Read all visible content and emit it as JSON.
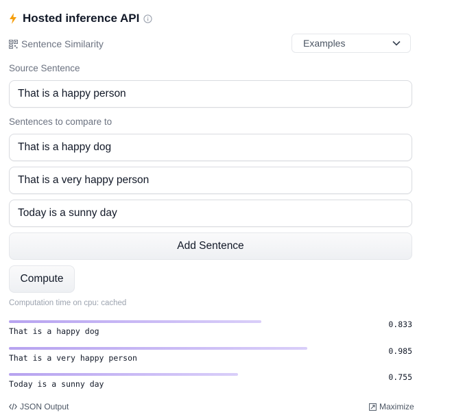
{
  "header": {
    "title": "Hosted inference API"
  },
  "task": {
    "label": "Sentence Similarity"
  },
  "examples": {
    "label": "Examples"
  },
  "source": {
    "label": "Source Sentence",
    "value": "That is a happy person"
  },
  "compare": {
    "label": "Sentences to compare to",
    "sentences": [
      "That is a happy dog",
      "That is a very happy person",
      "Today is a sunny day"
    ]
  },
  "buttons": {
    "add": "Add Sentence",
    "compute": "Compute"
  },
  "computation": {
    "text": "Computation time on cpu: cached"
  },
  "results": [
    {
      "label": "That is a happy dog",
      "score": "0.833",
      "fraction": 0.833
    },
    {
      "label": "That is a very happy person",
      "score": "0.985",
      "fraction": 0.985
    },
    {
      "label": "Today is a sunny day",
      "score": "0.755",
      "fraction": 0.755
    }
  ],
  "footer": {
    "json_output": "JSON Output",
    "maximize": "Maximize"
  },
  "colors": {
    "accent": "#f59e0b",
    "bar": "#b7a3f0"
  }
}
